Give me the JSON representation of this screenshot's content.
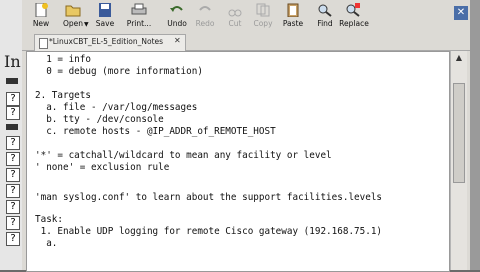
{
  "toolbar": {
    "new": "New",
    "open": "Open",
    "save": "Save",
    "print": "Print...",
    "undo": "Undo",
    "redo": "Redo",
    "cut": "Cut",
    "copy": "Copy",
    "paste": "Paste",
    "find": "Find",
    "replace": "Replace"
  },
  "tab": {
    "label": "*LinuxCBT_EL-5_Edition_Notes"
  },
  "background_glyph": "In",
  "editor": {
    "lines": [
      "  1 = info",
      "  0 = debug (more information)",
      "",
      "2. Targets",
      "  a. file - /var/log/messages",
      "  b. tty - /dev/console",
      "  c. remote hosts - @IP_ADDR_of_REMOTE_HOST",
      "",
      "'*' = catchall/wildcard to mean any facility or level",
      "' none' = exclusion rule",
      "",
      "",
      "'man syslog.conf' to learn about the support facilities.levels",
      "",
      "Task:",
      " 1. Enable UDP logging for remote Cisco gateway (192.168.75.1)",
      "  a."
    ]
  }
}
